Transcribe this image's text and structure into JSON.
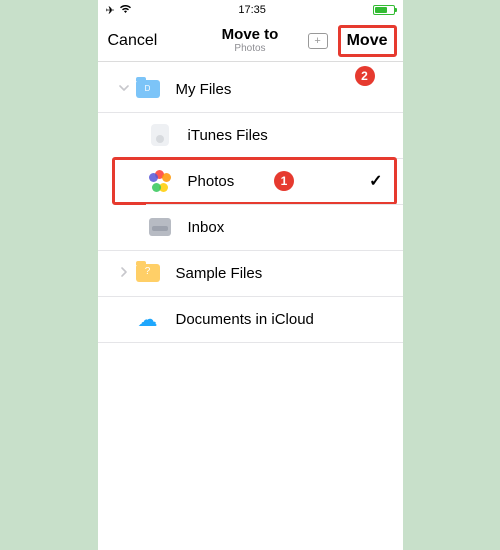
{
  "status": {
    "time": "17:35"
  },
  "nav": {
    "cancel": "Cancel",
    "title": "Move to",
    "subtitle": "Photos",
    "move": "Move"
  },
  "callouts": {
    "one": "1",
    "two": "2"
  },
  "rows": {
    "myfiles": "My Files",
    "itunes": "iTunes Files",
    "photos": "Photos",
    "inbox": "Inbox",
    "sample": "Sample Files",
    "icloud": "Documents in iCloud"
  }
}
